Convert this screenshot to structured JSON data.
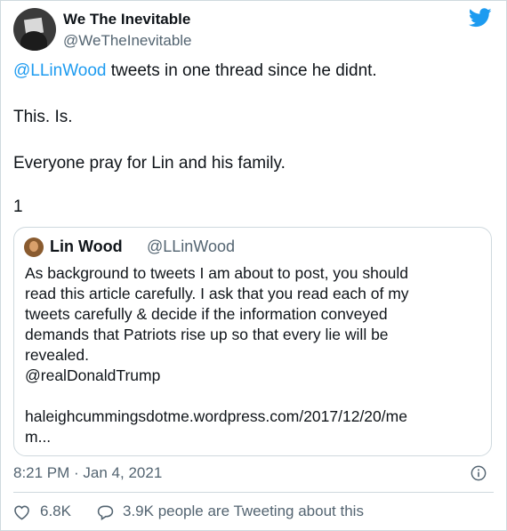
{
  "author": {
    "name": "We The Inevitable",
    "handle": "@WeTheInevitable"
  },
  "tweet": {
    "mention": "@LLinWood",
    "line1_rest": " tweets in one thread since he didnt.",
    "line2": "This. Is.",
    "line3": "Everyone pray for Lin and his family.",
    "line4": "1"
  },
  "quoted": {
    "name": "Lin Wood",
    "handle": "@LLinWood",
    "lines": [
      "As background to tweets I am about to post, you should",
      "read this article carefully. I ask that you read each of my",
      "tweets carefully & decide if the information conveyed",
      "demands that Patriots rise up so that every lie will be",
      "revealed.",
      "@realDonaldTrump",
      "haleighcummingsdotme.wordpress.com/2017/12/20/me",
      "m..."
    ]
  },
  "timestamp": "8:21 PM · Jan 4, 2021",
  "stats": {
    "likes": "6.8K",
    "conversation": "3.9K people are Tweeting about this"
  },
  "icons": {
    "brand": "twitter-bird-icon",
    "info": "info-icon",
    "like": "heart-icon",
    "reply": "speech-bubble-icon"
  },
  "colors": {
    "accent": "#1d9bf0",
    "secondary_text": "#536471",
    "border": "#cfd9de"
  }
}
